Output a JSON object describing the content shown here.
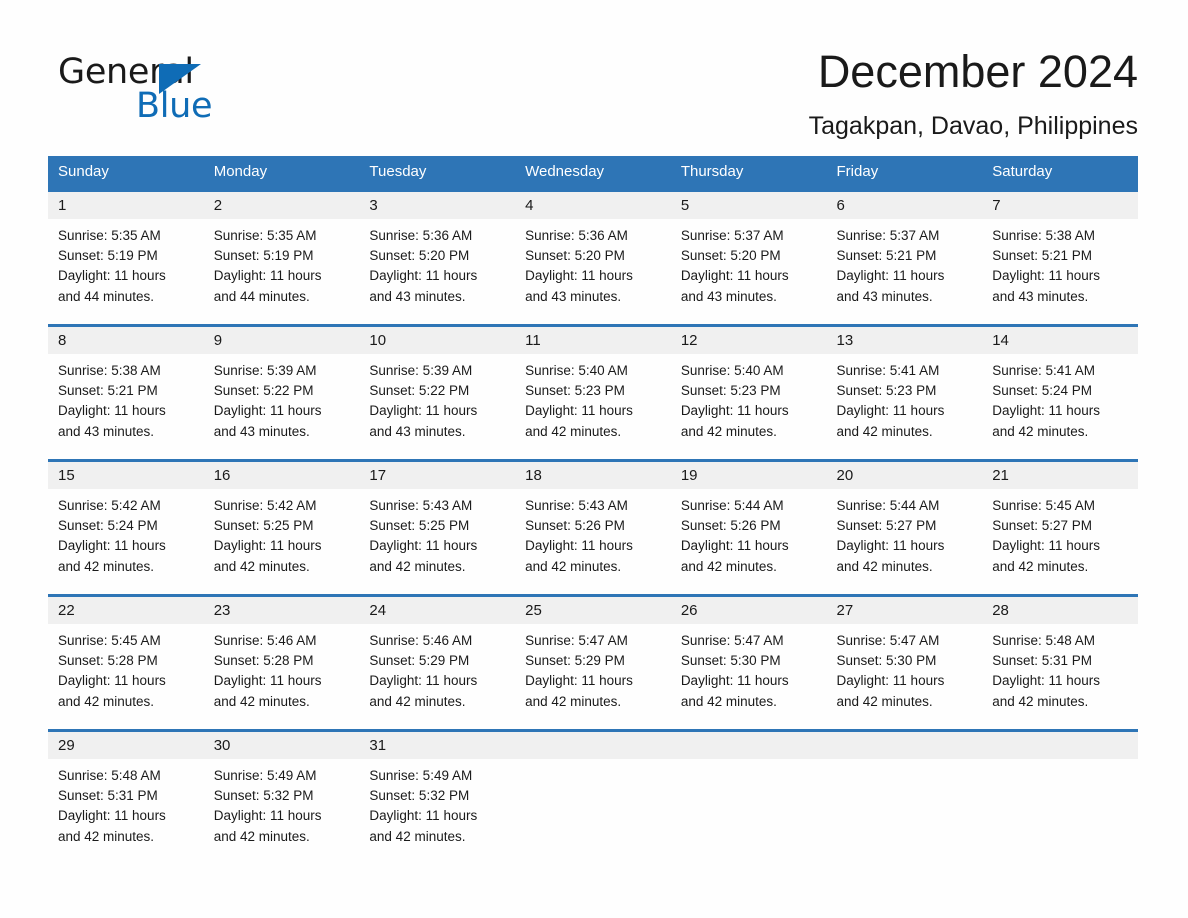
{
  "brand": {
    "name_part1": "General",
    "name_part2": "Blue",
    "flag_icon": "triangle-flag-icon"
  },
  "header": {
    "month_title": "December 2024",
    "location": "Tagakpan, Davao, Philippines"
  },
  "colors": {
    "header_blue": "#2e75b6",
    "brand_blue": "#0f6cb6",
    "daynum_band": "#f0f0f0",
    "text": "#1a1a1a",
    "page_background": "#fefefe"
  },
  "weekday_headers": [
    "Sunday",
    "Monday",
    "Tuesday",
    "Wednesday",
    "Thursday",
    "Friday",
    "Saturday"
  ],
  "labels": {
    "sunrise_prefix": "Sunrise:",
    "sunset_prefix": "Sunset:",
    "daylight_prefix": "Daylight:"
  },
  "weeks": [
    [
      {
        "day": "1",
        "sunrise": "Sunrise: 5:35 AM",
        "sunset": "Sunset: 5:19 PM",
        "daylight_line1": "Daylight: 11 hours",
        "daylight_line2": "and 44 minutes."
      },
      {
        "day": "2",
        "sunrise": "Sunrise: 5:35 AM",
        "sunset": "Sunset: 5:19 PM",
        "daylight_line1": "Daylight: 11 hours",
        "daylight_line2": "and 44 minutes."
      },
      {
        "day": "3",
        "sunrise": "Sunrise: 5:36 AM",
        "sunset": "Sunset: 5:20 PM",
        "daylight_line1": "Daylight: 11 hours",
        "daylight_line2": "and 43 minutes."
      },
      {
        "day": "4",
        "sunrise": "Sunrise: 5:36 AM",
        "sunset": "Sunset: 5:20 PM",
        "daylight_line1": "Daylight: 11 hours",
        "daylight_line2": "and 43 minutes."
      },
      {
        "day": "5",
        "sunrise": "Sunrise: 5:37 AM",
        "sunset": "Sunset: 5:20 PM",
        "daylight_line1": "Daylight: 11 hours",
        "daylight_line2": "and 43 minutes."
      },
      {
        "day": "6",
        "sunrise": "Sunrise: 5:37 AM",
        "sunset": "Sunset: 5:21 PM",
        "daylight_line1": "Daylight: 11 hours",
        "daylight_line2": "and 43 minutes."
      },
      {
        "day": "7",
        "sunrise": "Sunrise: 5:38 AM",
        "sunset": "Sunset: 5:21 PM",
        "daylight_line1": "Daylight: 11 hours",
        "daylight_line2": "and 43 minutes."
      }
    ],
    [
      {
        "day": "8",
        "sunrise": "Sunrise: 5:38 AM",
        "sunset": "Sunset: 5:21 PM",
        "daylight_line1": "Daylight: 11 hours",
        "daylight_line2": "and 43 minutes."
      },
      {
        "day": "9",
        "sunrise": "Sunrise: 5:39 AM",
        "sunset": "Sunset: 5:22 PM",
        "daylight_line1": "Daylight: 11 hours",
        "daylight_line2": "and 43 minutes."
      },
      {
        "day": "10",
        "sunrise": "Sunrise: 5:39 AM",
        "sunset": "Sunset: 5:22 PM",
        "daylight_line1": "Daylight: 11 hours",
        "daylight_line2": "and 43 minutes."
      },
      {
        "day": "11",
        "sunrise": "Sunrise: 5:40 AM",
        "sunset": "Sunset: 5:23 PM",
        "daylight_line1": "Daylight: 11 hours",
        "daylight_line2": "and 42 minutes."
      },
      {
        "day": "12",
        "sunrise": "Sunrise: 5:40 AM",
        "sunset": "Sunset: 5:23 PM",
        "daylight_line1": "Daylight: 11 hours",
        "daylight_line2": "and 42 minutes."
      },
      {
        "day": "13",
        "sunrise": "Sunrise: 5:41 AM",
        "sunset": "Sunset: 5:23 PM",
        "daylight_line1": "Daylight: 11 hours",
        "daylight_line2": "and 42 minutes."
      },
      {
        "day": "14",
        "sunrise": "Sunrise: 5:41 AM",
        "sunset": "Sunset: 5:24 PM",
        "daylight_line1": "Daylight: 11 hours",
        "daylight_line2": "and 42 minutes."
      }
    ],
    [
      {
        "day": "15",
        "sunrise": "Sunrise: 5:42 AM",
        "sunset": "Sunset: 5:24 PM",
        "daylight_line1": "Daylight: 11 hours",
        "daylight_line2": "and 42 minutes."
      },
      {
        "day": "16",
        "sunrise": "Sunrise: 5:42 AM",
        "sunset": "Sunset: 5:25 PM",
        "daylight_line1": "Daylight: 11 hours",
        "daylight_line2": "and 42 minutes."
      },
      {
        "day": "17",
        "sunrise": "Sunrise: 5:43 AM",
        "sunset": "Sunset: 5:25 PM",
        "daylight_line1": "Daylight: 11 hours",
        "daylight_line2": "and 42 minutes."
      },
      {
        "day": "18",
        "sunrise": "Sunrise: 5:43 AM",
        "sunset": "Sunset: 5:26 PM",
        "daylight_line1": "Daylight: 11 hours",
        "daylight_line2": "and 42 minutes."
      },
      {
        "day": "19",
        "sunrise": "Sunrise: 5:44 AM",
        "sunset": "Sunset: 5:26 PM",
        "daylight_line1": "Daylight: 11 hours",
        "daylight_line2": "and 42 minutes."
      },
      {
        "day": "20",
        "sunrise": "Sunrise: 5:44 AM",
        "sunset": "Sunset: 5:27 PM",
        "daylight_line1": "Daylight: 11 hours",
        "daylight_line2": "and 42 minutes."
      },
      {
        "day": "21",
        "sunrise": "Sunrise: 5:45 AM",
        "sunset": "Sunset: 5:27 PM",
        "daylight_line1": "Daylight: 11 hours",
        "daylight_line2": "and 42 minutes."
      }
    ],
    [
      {
        "day": "22",
        "sunrise": "Sunrise: 5:45 AM",
        "sunset": "Sunset: 5:28 PM",
        "daylight_line1": "Daylight: 11 hours",
        "daylight_line2": "and 42 minutes."
      },
      {
        "day": "23",
        "sunrise": "Sunrise: 5:46 AM",
        "sunset": "Sunset: 5:28 PM",
        "daylight_line1": "Daylight: 11 hours",
        "daylight_line2": "and 42 minutes."
      },
      {
        "day": "24",
        "sunrise": "Sunrise: 5:46 AM",
        "sunset": "Sunset: 5:29 PM",
        "daylight_line1": "Daylight: 11 hours",
        "daylight_line2": "and 42 minutes."
      },
      {
        "day": "25",
        "sunrise": "Sunrise: 5:47 AM",
        "sunset": "Sunset: 5:29 PM",
        "daylight_line1": "Daylight: 11 hours",
        "daylight_line2": "and 42 minutes."
      },
      {
        "day": "26",
        "sunrise": "Sunrise: 5:47 AM",
        "sunset": "Sunset: 5:30 PM",
        "daylight_line1": "Daylight: 11 hours",
        "daylight_line2": "and 42 minutes."
      },
      {
        "day": "27",
        "sunrise": "Sunrise: 5:47 AM",
        "sunset": "Sunset: 5:30 PM",
        "daylight_line1": "Daylight: 11 hours",
        "daylight_line2": "and 42 minutes."
      },
      {
        "day": "28",
        "sunrise": "Sunrise: 5:48 AM",
        "sunset": "Sunset: 5:31 PM",
        "daylight_line1": "Daylight: 11 hours",
        "daylight_line2": "and 42 minutes."
      }
    ],
    [
      {
        "day": "29",
        "sunrise": "Sunrise: 5:48 AM",
        "sunset": "Sunset: 5:31 PM",
        "daylight_line1": "Daylight: 11 hours",
        "daylight_line2": "and 42 minutes."
      },
      {
        "day": "30",
        "sunrise": "Sunrise: 5:49 AM",
        "sunset": "Sunset: 5:32 PM",
        "daylight_line1": "Daylight: 11 hours",
        "daylight_line2": "and 42 minutes."
      },
      {
        "day": "31",
        "sunrise": "Sunrise: 5:49 AM",
        "sunset": "Sunset: 5:32 PM",
        "daylight_line1": "Daylight: 11 hours",
        "daylight_line2": "and 42 minutes."
      },
      {
        "day": "",
        "sunrise": "",
        "sunset": "",
        "daylight_line1": "",
        "daylight_line2": ""
      },
      {
        "day": "",
        "sunrise": "",
        "sunset": "",
        "daylight_line1": "",
        "daylight_line2": ""
      },
      {
        "day": "",
        "sunrise": "",
        "sunset": "",
        "daylight_line1": "",
        "daylight_line2": ""
      },
      {
        "day": "",
        "sunrise": "",
        "sunset": "",
        "daylight_line1": "",
        "daylight_line2": ""
      }
    ]
  ]
}
